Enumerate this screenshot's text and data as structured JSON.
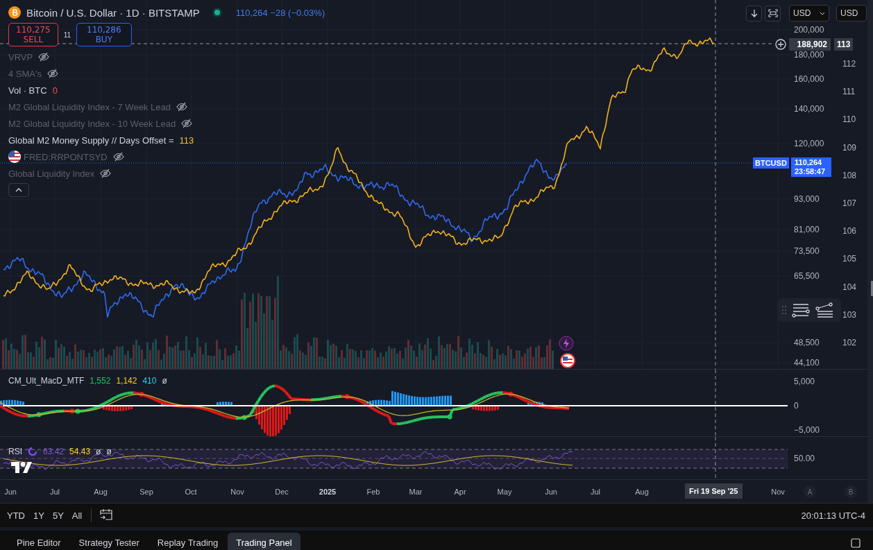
{
  "header": {
    "title": "Bitcoin / U.S. Dollar · 1D · BITSTAMP",
    "last_price": "110,264",
    "change": "−28 (−0.03%)"
  },
  "trade": {
    "sell_price": "110,275",
    "sell_label": "SELL",
    "spread": "11",
    "buy_price": "110,286",
    "buy_label": "BUY"
  },
  "indicators": [
    {
      "name": "VRVP",
      "hidden": true
    },
    {
      "name": "4 SMA's",
      "hidden": true
    },
    {
      "name": "Vol · BTC",
      "value": "0",
      "hidden": false
    },
    {
      "name": "M2 Global Liquidity Index - 7 Week Lead",
      "hidden": true
    },
    {
      "name": "M2 Global Liquidity Index - 10 Week Lead",
      "hidden": true
    },
    {
      "name": "Global M2 Money Supply // Days Offset =",
      "value": "113",
      "hidden": false
    },
    {
      "name": "FRED:RRPONTSYD",
      "hidden": true,
      "kind": "flag"
    },
    {
      "name": "Global Liquidity Index",
      "hidden": true
    }
  ],
  "toolbar": {
    "currency": "USD",
    "currency_secondary": "USD"
  },
  "price_axis": {
    "ticks": [
      "200,000",
      "180,000",
      "160,000",
      "140,000",
      "120,000",
      "93,000",
      "81,000",
      "73,500",
      "65,500",
      "48,500",
      "44,100"
    ],
    "crosshair_price": "188,902",
    "symbol_label": "BTCUSD",
    "last_price": "110,264",
    "countdown": "23:58:47"
  },
  "secondary_axis": {
    "ticks": [
      "112",
      "111",
      "110",
      "109",
      "108",
      "107",
      "106",
      "105",
      "104",
      "103",
      "102"
    ],
    "crosshair_value": "113"
  },
  "macd": {
    "name": "CM_Ult_MacD_MTF",
    "values": [
      {
        "text": "1,552",
        "color": "#22c55e"
      },
      {
        "text": "1,142",
        "color": "#facc15"
      },
      {
        "text": "410",
        "color": "#22d3ee"
      },
      {
        "text": "ø",
        "color": "#d1d4dc"
      }
    ],
    "ticks": [
      "5,000",
      "0",
      "−5,000"
    ]
  },
  "rsi": {
    "name": "RSI",
    "values": [
      {
        "text": "63.42",
        "color": "#7e57c2"
      },
      {
        "text": "54.43",
        "color": "#facc15"
      },
      {
        "text": "ø",
        "color": "#d1d4dc"
      },
      {
        "text": "ø",
        "color": "#d1d4dc"
      }
    ],
    "tick": "50.00"
  },
  "time_axis": {
    "labels": [
      "Jun",
      "Jul",
      "Aug",
      "Sep",
      "Oct",
      "Nov",
      "Dec",
      "2025",
      "Feb",
      "Mar",
      "Apr",
      "May",
      "Jun",
      "Jul",
      "Aug",
      "Nov"
    ],
    "crosshair_date": "Fri 19 Sep '25",
    "buttons": [
      "A",
      "B"
    ]
  },
  "ranges": [
    "YTD",
    "1Y",
    "5Y",
    "All"
  ],
  "clock": "20:01:13 UTC-4",
  "panel_tabs": [
    {
      "label": "Pine Editor",
      "selected": false
    },
    {
      "label": "Strategy Tester",
      "selected": false
    },
    {
      "label": "Replay Trading",
      "selected": false
    },
    {
      "label": "Trading Panel",
      "selected": true
    }
  ]
}
